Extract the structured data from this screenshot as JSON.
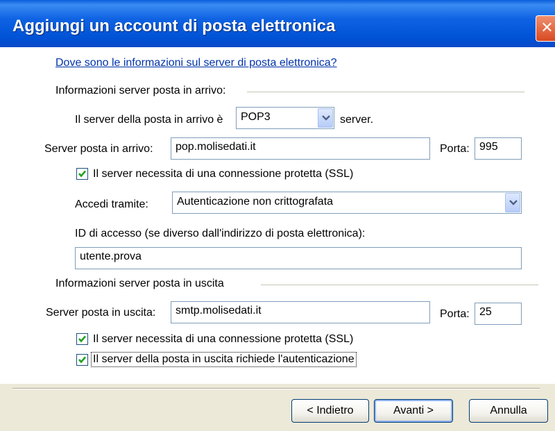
{
  "window": {
    "title": "Aggiungi un account di posta elettronica",
    "close_label": "✕"
  },
  "help_link": "Dove sono le informazioni sul server di posta elettronica?",
  "incoming": {
    "section_title": "Informazioni server posta in arrivo:",
    "server_type_prefix": "Il server della posta in arrivo è",
    "server_type_value": "POP3",
    "server_type_suffix": "server.",
    "server_label": "Server posta in arrivo:",
    "server_value": "pop.molisedati.it",
    "port_label": "Porta:",
    "port_value": "995",
    "ssl_label": "Il server necessita di una connessione protetta (SSL)",
    "ssl_checked": true,
    "logon_label": "Accedi tramite:",
    "logon_value": "Autenticazione non crittografata",
    "id_label": "ID di accesso (se diverso dall'indirizzo di posta elettronica):",
    "id_value": "utente.prova"
  },
  "outgoing": {
    "section_title": "Informazioni server posta in uscita",
    "server_label": "Server posta in uscita:",
    "server_value": "smtp.molisedati.it",
    "port_label": "Porta:",
    "port_value": "25",
    "ssl_label": "Il server necessita di una connessione protetta (SSL)",
    "ssl_checked": true,
    "auth_label": "Il server della posta in uscita richiede l'autenticazione",
    "auth_checked": true
  },
  "buttons": {
    "back": "< Indietro",
    "next": "Avanti >",
    "cancel": "Annulla"
  },
  "colors": {
    "titlebar": "#0052d6",
    "link": "#0033aa",
    "check": "#21a121",
    "dialog_bg": "#ece9d8"
  },
  "icons": {
    "close": "close-icon",
    "dropdown": "chevron-down-icon",
    "checkmark": "checkmark-icon"
  }
}
